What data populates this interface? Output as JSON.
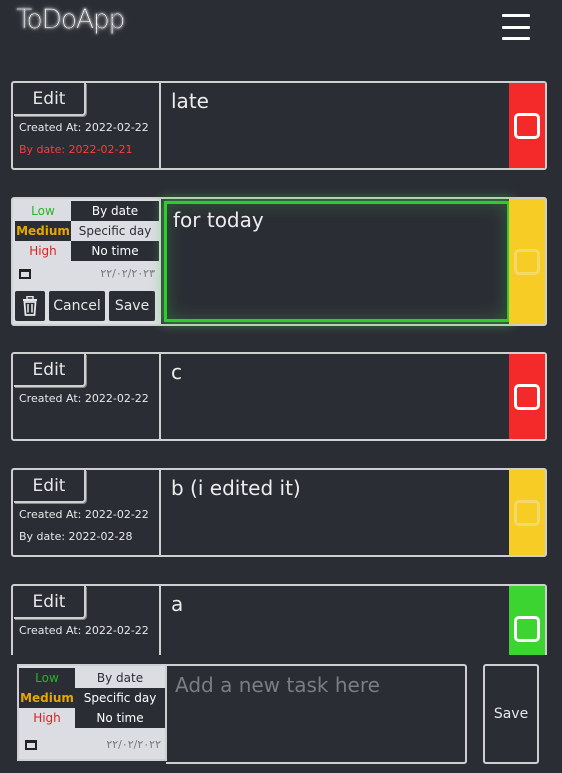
{
  "app": {
    "title": "ToDoApp"
  },
  "labels": {
    "edit": "Edit",
    "cancel": "Cancel",
    "save": "Save"
  },
  "priority_options": {
    "low": "Low",
    "medium": "Medium",
    "high": "High"
  },
  "date_options": {
    "by_date": "By date",
    "specific_day": "Specific day",
    "no_time": "No time"
  },
  "colors": {
    "red": "#f42a2a",
    "yellow": "#f7cc24",
    "green": "#3bd431",
    "focus": "#2fcb2f"
  },
  "tasks": [
    {
      "text": "late",
      "created": "Created At: 2022-02-22",
      "by_date": "By date: 2022-02-21",
      "priority_color": "red"
    },
    {
      "text": "for today",
      "editing": true,
      "date_value": "٢٢/٠٢/٢٠٢٣",
      "priority_color": "yellow"
    },
    {
      "text": "c",
      "created": "Created At: 2022-02-22",
      "priority_color": "red"
    },
    {
      "text": "b (i edited it)",
      "created": "Created At: 2022-02-22",
      "by_date": "By date: 2022-02-28",
      "priority_color": "yellow"
    },
    {
      "text": "a",
      "created": "Created At: 2022-02-22",
      "priority_color": "green"
    }
  ],
  "new_task": {
    "placeholder": "Add a new task here",
    "date_value": "٢٢/٠٢/٢٠٢٢",
    "save_label": "Save"
  }
}
